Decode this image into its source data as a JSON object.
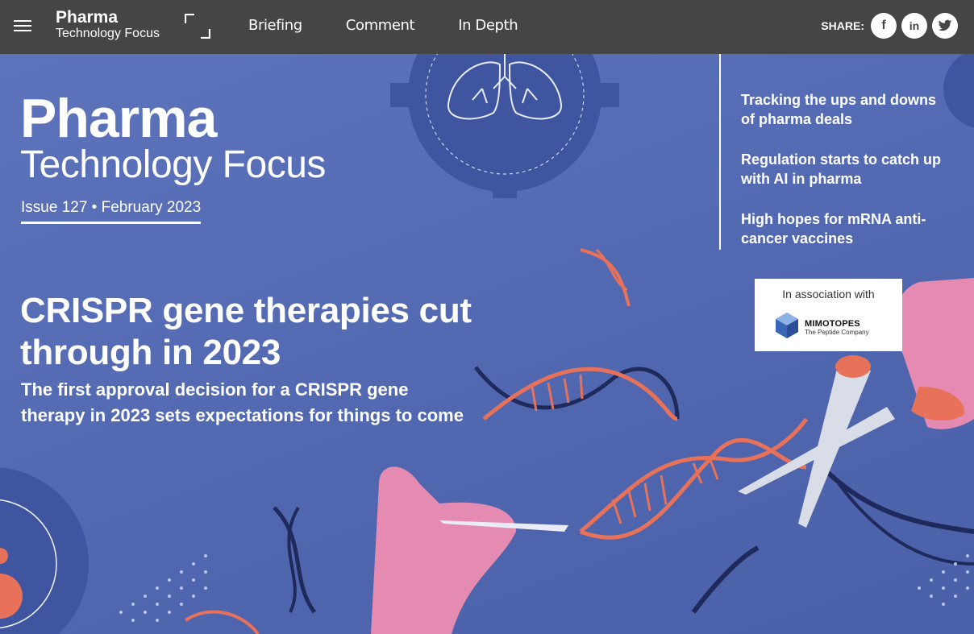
{
  "header": {
    "brand_top": "Pharma",
    "brand_bottom": "Technology Focus",
    "nav": [
      "Briefing",
      "Comment",
      "In Depth"
    ],
    "share_label": "SHARE:",
    "social": [
      {
        "name": "facebook-icon",
        "glyph": "f"
      },
      {
        "name": "linkedin-icon",
        "glyph": "in"
      },
      {
        "name": "twitter-icon",
        "glyph": "🐦"
      }
    ]
  },
  "hero": {
    "mag_title_top": "Pharma",
    "mag_title_bottom": "Technology Focus",
    "issue": "Issue 127 • February 2023",
    "headline": "CRISPR gene therapies cut through in 2023",
    "subhead": "The first approval decision for a CRISPR gene therapy in 2023 sets expectations for things to come",
    "side_links": [
      "Tracking the ups and downs of pharma deals",
      "Regulation starts to catch up with AI in pharma",
      "High hopes for mRNA anti-cancer vaccines"
    ],
    "association": {
      "label": "In association with",
      "company": "MIMOTOPES",
      "tagline": "The Peptide Company"
    }
  },
  "colors": {
    "topbar": "#454545",
    "hero_bg": "#5a70b8",
    "accent_salmon": "#e8715a",
    "accent_pink": "#e58ab0",
    "dna_navy": "#1f2a5c"
  }
}
